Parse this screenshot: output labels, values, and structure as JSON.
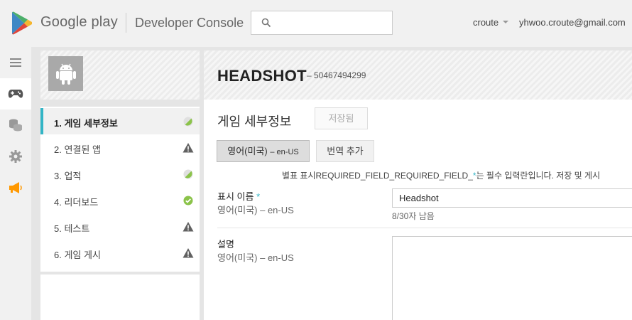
{
  "header": {
    "logo_text": "Google play",
    "console_text": "Developer Console",
    "search_placeholder": "",
    "user_name": "croute",
    "user_email": "yhwoo.croute@gmail.com"
  },
  "rail": {
    "items": [
      {
        "icon": "menu-icon"
      },
      {
        "icon": "gamepad-icon",
        "active": true
      },
      {
        "icon": "coins-icon"
      },
      {
        "icon": "gear-icon"
      },
      {
        "icon": "megaphone-icon"
      }
    ]
  },
  "app": {
    "title": "HEADSHOT",
    "id": "– 50467494299"
  },
  "nav": {
    "items": [
      {
        "label": "1. 게임 세부정보",
        "status": "partial"
      },
      {
        "label": "2. 연결된 앱",
        "status": "warning"
      },
      {
        "label": "3. 업적",
        "status": "partial"
      },
      {
        "label": "4. 리더보드",
        "status": "complete"
      },
      {
        "label": "5. 테스트",
        "status": "warning"
      },
      {
        "label": "6. 게임 게시",
        "status": "warning"
      }
    ]
  },
  "content": {
    "section_title": "게임 세부정보",
    "saved_label": "저장됨",
    "lang_label": "영어(미국)",
    "lang_sub": "– en-US",
    "add_translation_label": "번역 추가",
    "required_note_prefix": "별표 표시REQUIRED_FIELD_REQUIRED_FIELD_",
    "required_note_star": "*",
    "required_note_suffix": "는 필수 입력란입니다. 저장 및 게시",
    "fields": {
      "title_label": "표시 이름",
      "title_star": "*",
      "title_lang": "영어(미국) – en-US",
      "title_value": "Headshot",
      "title_count": "8/30자 남음",
      "desc_label": "설명",
      "desc_lang": "영어(미국) – en-US"
    }
  },
  "colors": {
    "accent": "#33b5c6",
    "warning": "#616161",
    "complete": "#8bc34a",
    "megaphone": "#ff9800"
  }
}
